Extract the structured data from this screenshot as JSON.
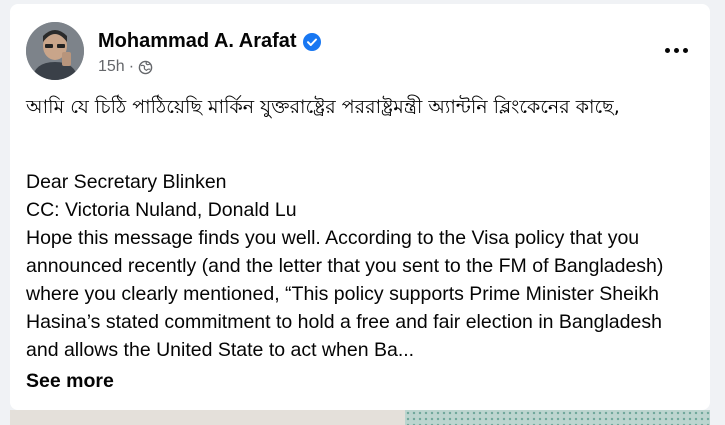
{
  "post": {
    "author": "Mohammad A. Arafat",
    "timestamp": "15h",
    "separator": "·",
    "verified_icon": "verified-badge-icon",
    "privacy_icon": "globe-icon",
    "menu_icon": "more-options-icon",
    "headline": "আমি যে চিঠি পাঠিয়েছি মার্কিন যুক্তরাষ্ট্রের পররাষ্ট্রমন্ত্রী অ্যান্টনি ব্লিংকেনের কাছে,",
    "body_lines": [
      "Dear Secretary Blinken",
      "CC: Victoria Nuland, Donald Lu",
      "Hope this message finds you well. According to the Visa policy that you announced recently (and the letter that you sent to the FM of Bangladesh) where you clearly mentioned, “This policy supports Prime Minister Sheikh Hasina’s stated commitment to hold a free and fair election in Bangladesh and allows the United State to act when Ba..."
    ],
    "see_more": "See more"
  },
  "colors": {
    "verified": "#1877f2",
    "secondary_text": "#65676b",
    "background": "#f0f2f5"
  }
}
